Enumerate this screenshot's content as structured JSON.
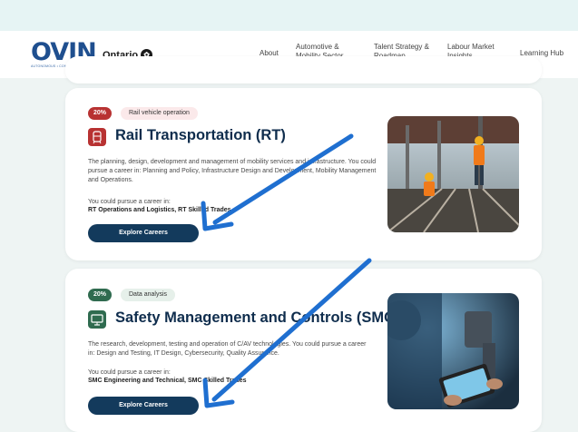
{
  "header": {
    "logo_text": "OVIN",
    "logo_tagline": "AUTONOMOUS • CONNECTED • ELECTRIC",
    "ontario_label": "Ontario",
    "nav": [
      {
        "label": "About"
      },
      {
        "label": "Automotive & Mobility Sector"
      },
      {
        "label": "Talent Strategy & Roadmap"
      },
      {
        "label": "Labour Market Insights"
      },
      {
        "label": "Learning Hub"
      }
    ]
  },
  "cards": [
    {
      "percent": "20%",
      "skill": "Rail vehicle operation",
      "title": "Rail Transportation (RT)",
      "description": "The planning, design, development and management of mobility services and infrastructure. You could pursue a career in: Planning and Policy, Infrastructure Design and Development, Mobility Management and Operations.",
      "pursue_label": "You could pursue a career in:",
      "careers": "RT Operations and Logistics, RT Skilled Trades",
      "button": "Explore Careers",
      "icon": "train-icon",
      "accent": "#b83232"
    },
    {
      "percent": "20%",
      "skill": "Data analysis",
      "title": "Safety Management and Controls (SMC)",
      "description": "The research, development, testing and operation of C/AV technologies. You could pursue a career in: Design and Testing, IT Design, Cybersecurity, Quality Assurance.",
      "pursue_label": "You could pursue a career in:",
      "careers": "SMC Engineering and Technical, SMC Skilled Trades",
      "button": "Explore Careers",
      "icon": "monitor-icon",
      "accent": "#2f6b4f"
    }
  ],
  "colors": {
    "annotation_arrow": "#1f6fd0",
    "button": "#133a5c",
    "title": "#0f2d4d"
  }
}
